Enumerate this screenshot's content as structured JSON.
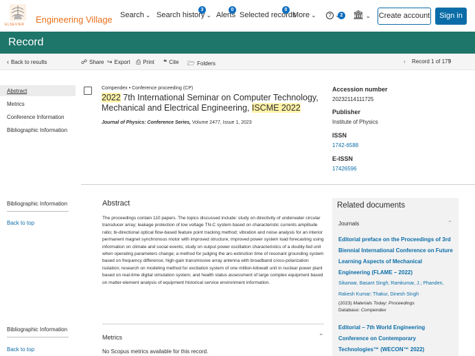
{
  "brand": {
    "name": "Engineering Village",
    "logo_text": "ELSEVIER"
  },
  "nav": {
    "search": "Search",
    "search_history": "Search history",
    "search_history_badge": "3",
    "alerts": "Alerts",
    "alerts_badge": "0",
    "selected_records": "Selected records",
    "selected_records_badge": "0",
    "more": "More",
    "help_badge": "2",
    "create_account": "Create account",
    "sign_in": "Sign in"
  },
  "page_title": "Record",
  "toolbar": {
    "back": "Back to results",
    "share": "Share",
    "export": "Export",
    "print": "Print",
    "cite": "Cite",
    "folders": "Folders",
    "record_position": "Record 1 of 175"
  },
  "left_nav": {
    "items": [
      "Abstract",
      "Metrics",
      "Conference Information",
      "Bibliographic Information"
    ],
    "section_label_1": "Bibliographic Information",
    "back_to_top_1": "Back to top",
    "section_label_2": "Bibliographic Information",
    "back_to_top_2": "Back to top"
  },
  "record": {
    "database": "Compendex",
    "doc_type": "Conference proceeding (CP)",
    "title_year": "2022",
    "title_mid": " 7th International Seminar on Computer Technology, Mechanical and Electrical Engineering, ",
    "title_acronym": "ISCME 2022",
    "journal": "Journal of Physics: Conference Series,",
    "journal_details": " Volume 2477, Issue 1, 2023",
    "accession_label": "Accession number",
    "accession": "20232114111725",
    "publisher_label": "Publisher",
    "publisher": "Institute of Physics",
    "issn_label": "ISSN",
    "issn": "1742-6588",
    "eissn_label": "E-ISSN",
    "eissn": "17426596"
  },
  "abstract": {
    "heading": "Abstract",
    "text": "The proceedings contain 110 papers. The topics discussed include: study on directivity of underwater circular transducer array; leakage protection of low voltage TN-C system based on characteristic currents amplitude ratio; bi-directional optical flow-based feature point tracking method; vibration and noise analysis for an interior permanent magnet synchronous motor with improved structure; improved power system load forecasting using information on climate and social events; study on output power oscillation characteristics of a doubly-fed unit when operating parameters change; a method for judging the arc-extinction time of resonant grounding system based on frequency difference; high-gain transmissive array antenna with broadband cross-polarization isolation; research on modeling method for excitation system of one million-kilowatt unit in nuclear power plant based on real-time digital simulation system; and health status assessment of large complex equipment based on matter-element analysis of equipment historical service environment information."
  },
  "metrics": {
    "heading": "Metrics",
    "text": "No Scopus metrics available for this record."
  },
  "related": {
    "heading": "Related documents",
    "section": "Journals",
    "items": [
      {
        "title": "Editorial preface on the Proceedings of 3rd Biennial International Conference on Future Learning Aspects of Mechanical Engineering (FLAME – 2022)",
        "authors": "Sikarwar, Basant Singh; Ramkumar, J.; Phanden, Rakesh Kumar; Thakur, Dinesh Singh",
        "year": "(2023)",
        "source": "Materials Today: Proceedings",
        "database_label": "Database:",
        "database": "Compendex"
      },
      {
        "title": "Editorial – 7th World Engineering Conference on Contemporary Technologies™ (WECON™ 2022)"
      }
    ]
  }
}
